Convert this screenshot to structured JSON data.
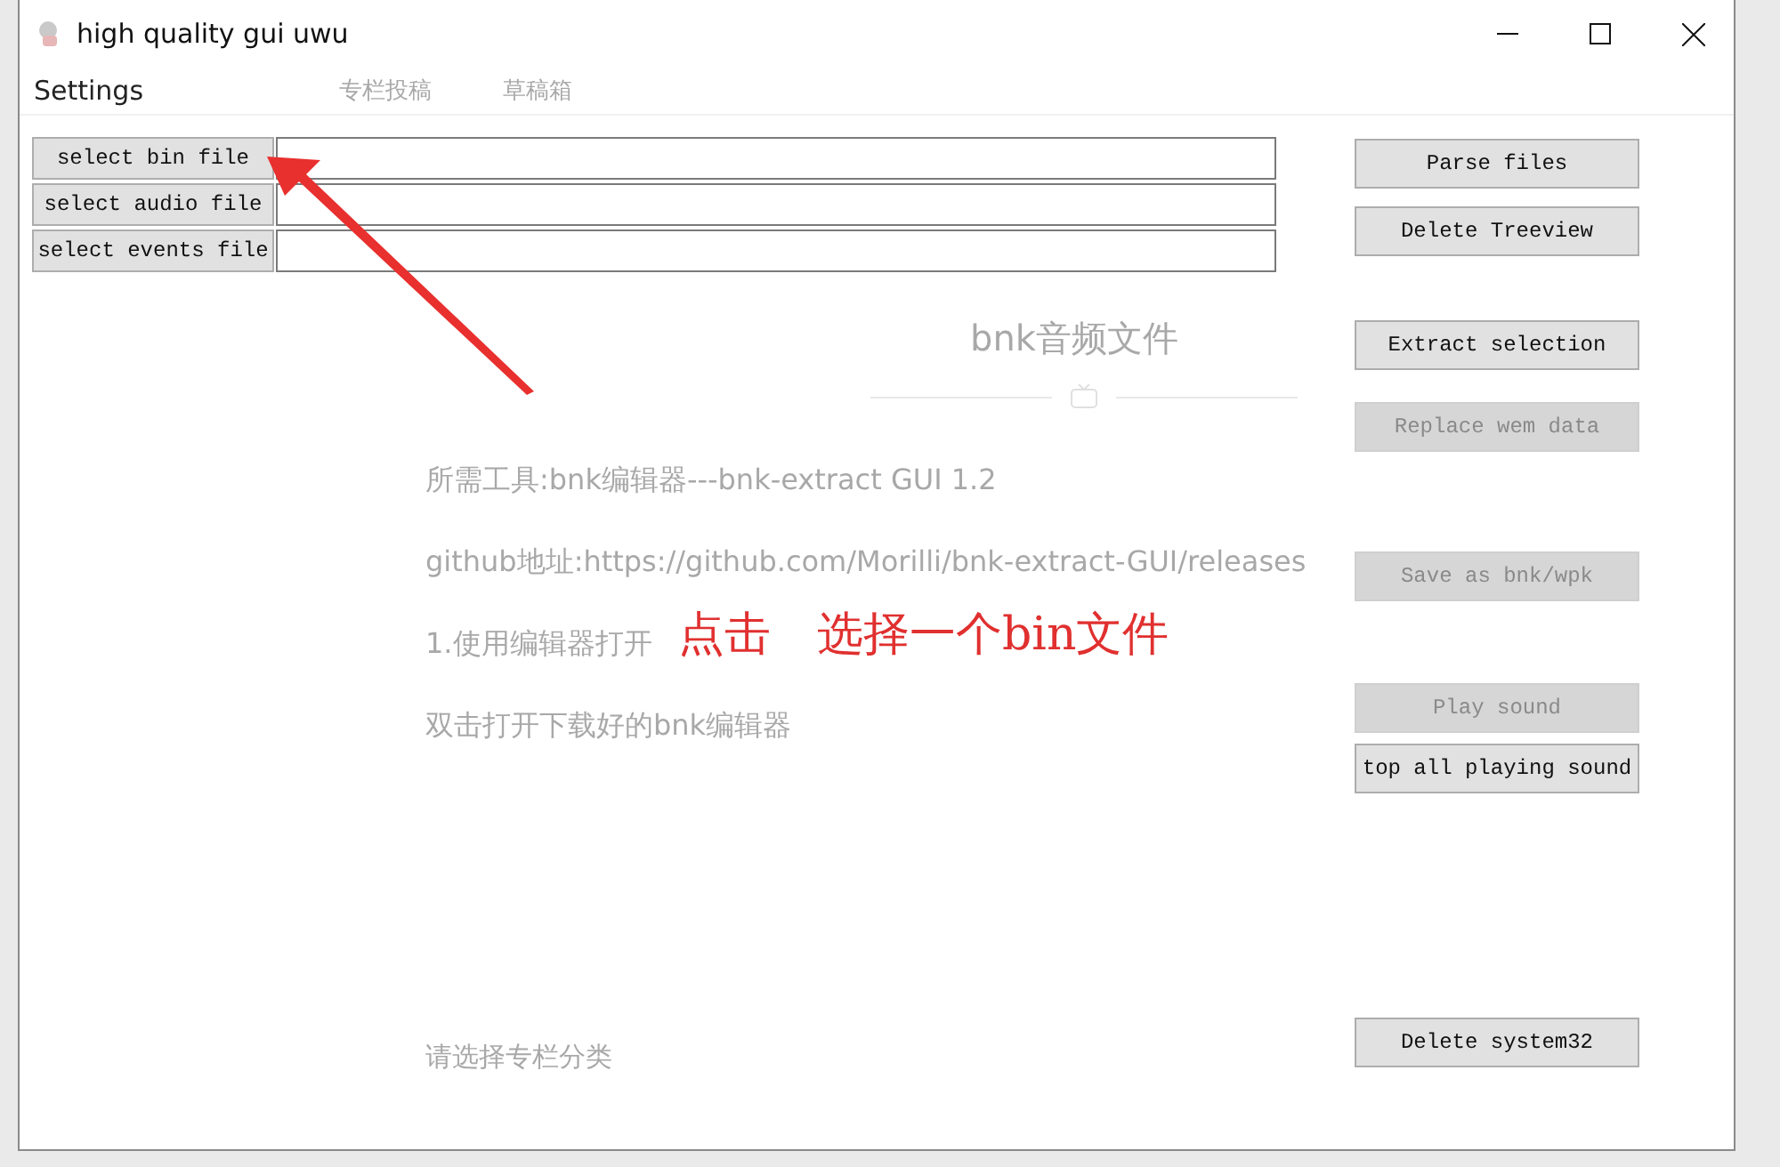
{
  "window": {
    "title": "high quality gui uwu"
  },
  "menu": [
    "Settings"
  ],
  "background_tabs": [
    "专栏投稿",
    "草稿箱"
  ],
  "file_rows": [
    {
      "button": "select bin file",
      "value": ""
    },
    {
      "button": "select audio file",
      "value": ""
    },
    {
      "button": "select events file",
      "value": ""
    }
  ],
  "actions": [
    {
      "label": "Parse files",
      "disabled": false
    },
    {
      "label": "Delete Treeview",
      "disabled": false
    },
    {
      "label": "Extract selection",
      "disabled": false
    },
    {
      "label": "Replace wem data",
      "disabled": true
    },
    {
      "label": "Save as bnk/wpk",
      "disabled": true
    },
    {
      "label": "Play sound",
      "disabled": true
    },
    {
      "label": "top all playing sound",
      "disabled": false
    },
    {
      "label": "Delete system32",
      "disabled": false
    }
  ],
  "background_article": {
    "title": "bnk音频文件",
    "paragraphs": [
      "所需工具:bnk编辑器---bnk-extract GUI 1.2",
      "github地址:https://github.com/Morilli/bnk-extract-GUI/releases",
      "1.使用编辑器打开",
      "双击打开下载好的bnk编辑器"
    ],
    "category_hint": "请选择专栏分类"
  },
  "annotation": "点击　选择一个bin文件"
}
